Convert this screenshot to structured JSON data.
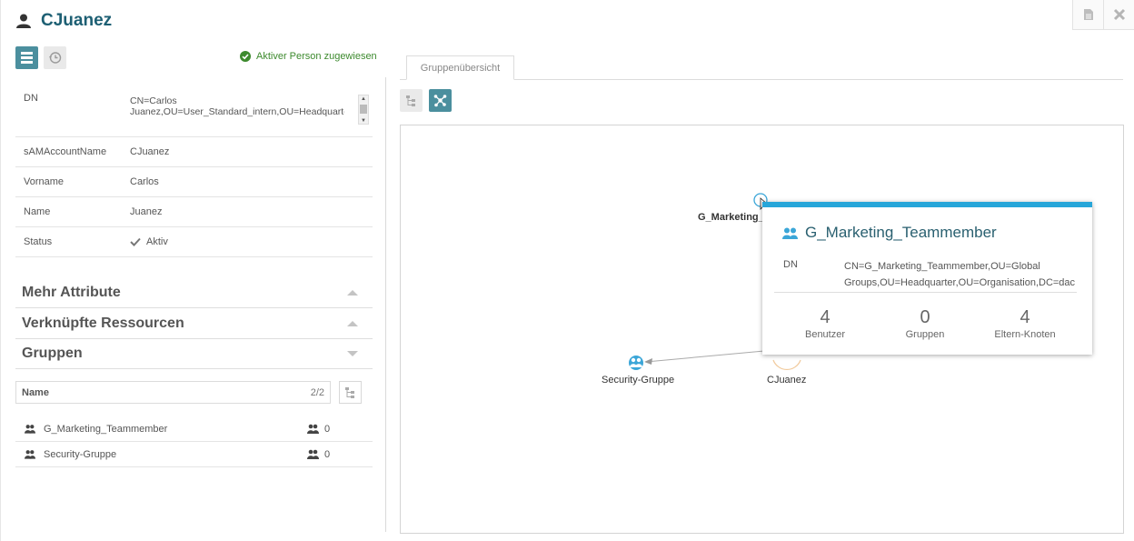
{
  "header": {
    "title": "CJuanez",
    "user_icon": "user-icon",
    "doc_icon": "document-icon",
    "close_icon": "close-icon"
  },
  "toolbar": {
    "list_view_icon": "list-icon",
    "history_icon": "history-icon",
    "assigned_text": "Aktiver Person zugewiesen"
  },
  "attributes": {
    "dn_key": "DN",
    "dn_value": "CN=Carlos Juanez,OU=User_Standard_intern,OU=Headquarter,OU=Organisation,DC=daccord,DC=de",
    "sam_key": "sAMAccountName",
    "sam_value": "CJuanez",
    "vorname_key": "Vorname",
    "vorname_value": "Carlos",
    "name_key": "Name",
    "name_value": "Juanez",
    "status_key": "Status",
    "status_value": "Aktiv"
  },
  "sections": {
    "mehr_attribute": "Mehr Attribute",
    "verknuepfte_ressourcen": "Verknüpfte Ressourcen",
    "gruppen": "Gruppen"
  },
  "groups_table": {
    "name_header": "Name",
    "count": "2/2",
    "rows": [
      {
        "name": "G_Marketing_Teammember",
        "members": "0"
      },
      {
        "name": "Security-Gruppe",
        "members": "0"
      }
    ]
  },
  "graph_panel": {
    "tab_label": "Gruppenübersicht",
    "nodes": {
      "marketing": "G_Marketing_",
      "security": "Security-Gruppe",
      "user": "CJuanez"
    }
  },
  "tooltip": {
    "title": "G_Marketing_Teammember",
    "dn_key": "DN",
    "dn_value": "CN=G_Marketing_Teammember,OU=Global Groups,OU=Headquarter,OU=Organisation,DC=dac",
    "stats": [
      {
        "value": "4",
        "label": "Benutzer"
      },
      {
        "value": "0",
        "label": "Gruppen"
      },
      {
        "value": "4",
        "label": "Eltern-Knoten"
      }
    ]
  },
  "colors": {
    "accent": "#4b8f9e",
    "title": "#1d5f73",
    "success": "#3d8a2e",
    "tooltip_border": "#27a6d9",
    "node_blue": "#3ba6d8"
  }
}
